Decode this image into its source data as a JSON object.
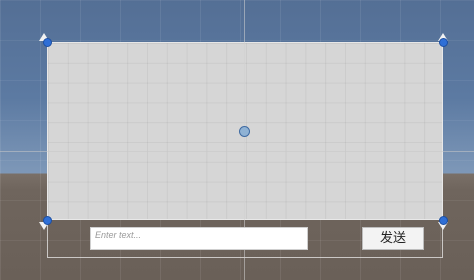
{
  "input": {
    "placeholder": "Enter text..."
  },
  "send_button": {
    "label": "发送"
  }
}
